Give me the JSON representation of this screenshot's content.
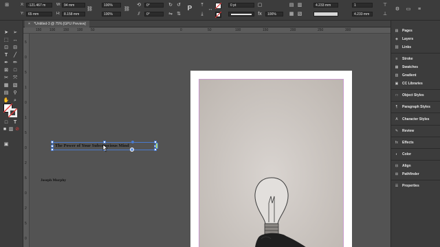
{
  "control_bar": {
    "x_label": "X:",
    "x_value": "-121.467 m",
    "y_label": "Y:",
    "y_value": "65 mm",
    "w_label": "W:",
    "w_value": "94 mm",
    "h_label": "H:",
    "h_value": "8.158 mm",
    "scale_x": "100%",
    "scale_y": "100%",
    "rotate": "0°",
    "shear": "0°",
    "stroke_weight": "0 pt",
    "opacity": "100%",
    "dim_1": "4.233 mm",
    "dim_2": "4.233 mm",
    "col_count": "1"
  },
  "document_tab": {
    "title": "*Untitled-3 @ 75% [GPU Preview]",
    "close": "×"
  },
  "ruler_h": [
    "150",
    "100",
    "150",
    "100",
    "50",
    "0",
    "50",
    "100",
    "150",
    "200",
    "250",
    "300"
  ],
  "ruler_v": [
    "5",
    "0",
    "5",
    "1",
    "0",
    "1",
    "5",
    "0",
    "2",
    "5",
    "0",
    "2",
    "5",
    "0"
  ],
  "canvas": {
    "headline": "The Power of Your Subconscious Mind",
    "author": "Joseph Murphy"
  },
  "panels": [
    {
      "label": "Pages",
      "icon": "▤"
    },
    {
      "label": "Layers",
      "icon": "◈"
    },
    {
      "label": "Links",
      "icon": "⛓"
    },
    {
      "label": "Stroke",
      "icon": "≡"
    },
    {
      "label": "Swatches",
      "icon": "▦"
    },
    {
      "label": "Gradient",
      "icon": "▥"
    },
    {
      "label": "CC Libraries",
      "icon": "▣"
    },
    {
      "label": "Object Styles",
      "icon": "□"
    },
    {
      "label": "Paragraph Styles",
      "icon": "¶"
    },
    {
      "label": "Character Styles",
      "icon": "A"
    },
    {
      "label": "Review",
      "icon": "✎"
    },
    {
      "label": "Effects",
      "icon": "fx"
    },
    {
      "label": "Color",
      "icon": "◐"
    },
    {
      "label": "Align",
      "icon": "⊟"
    },
    {
      "label": "Pathfinder",
      "icon": "⊞"
    },
    {
      "label": "Properties",
      "icon": "☰"
    }
  ],
  "colors": {
    "selection": "#4a7bd0",
    "frame_edge": "#c99ad0",
    "accent_red": "#e03a3a"
  }
}
